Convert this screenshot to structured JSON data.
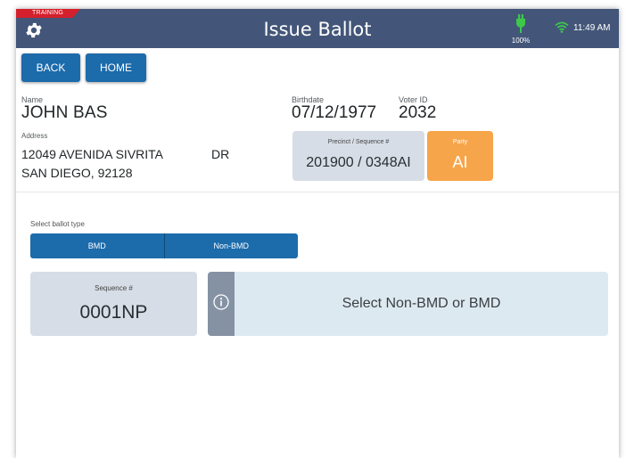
{
  "header": {
    "training_badge": "TRAINING",
    "title": "Issue Ballot",
    "battery_level": "100%",
    "time": "11:49 AM",
    "bar_color": "#435679",
    "badge_color": "#d4202c",
    "battery_color": "#3ec84a",
    "wifi_color": "#3ec84a"
  },
  "nav": {
    "back_label": "BACK",
    "home_label": "HOME"
  },
  "voter": {
    "name_label": "Name",
    "name": "JOHN BAS",
    "address_label": "Address",
    "address_line1": "12049 AVENIDA SIVRITA",
    "address_suffix": "DR",
    "address_line2": "SAN DIEGO, 92128",
    "birthdate_label": "Birthdate",
    "birthdate": "07/12/1977",
    "voter_id_label": "Voter ID",
    "voter_id": "2032",
    "precinct_label": "Precinct / Sequence #",
    "precinct_value": "201900 / 0348AI",
    "party_label": "Party",
    "party_value": "AI",
    "party_color": "#f7a54a"
  },
  "ballot": {
    "select_label": "Select ballot type",
    "options": [
      "BMD",
      "Non-BMD"
    ],
    "accent_color": "#1c6bab",
    "sequence_label": "Sequence #",
    "sequence_value": "0001NP",
    "message": "Select Non-BMD or BMD"
  },
  "icons": {
    "settings": "gear-icon",
    "battery": "battery-charging-icon",
    "wifi": "wifi-icon",
    "info": "info-icon"
  }
}
